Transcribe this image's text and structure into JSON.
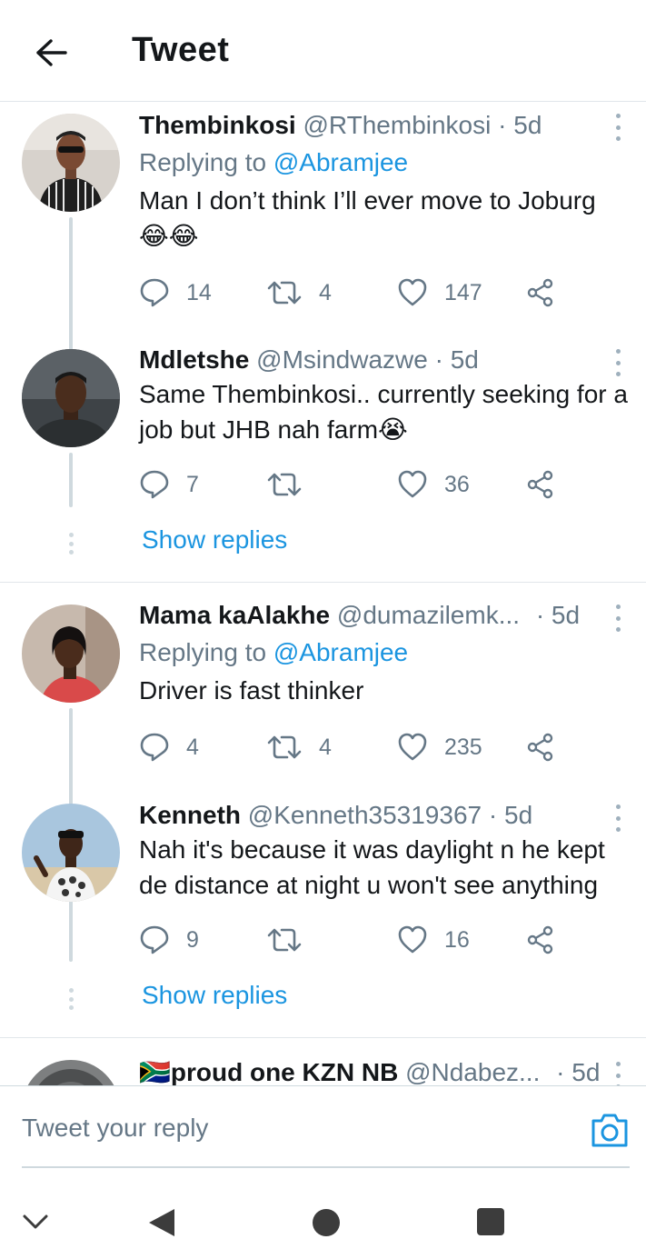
{
  "header": {
    "title": "Tweet"
  },
  "tweets": [
    {
      "name": "Thembinkosi",
      "handle": "@RThembinkosi",
      "time": "· 5d",
      "replying_prefix": "Replying to ",
      "replying_to": "@Abramjee",
      "text": "Man I don’t think I’ll ever move to Joburg",
      "emoji": "😂😂",
      "replies": "14",
      "retweets": "4",
      "likes": "147"
    },
    {
      "name": "Mdletshe",
      "handle": "@Msindwazwe",
      "time": "· 5d",
      "text": "Same Thembinkosi.. currently seeking for a job but JHB nah farm",
      "emoji": "😭",
      "replies": "7",
      "retweets": "",
      "likes": "36",
      "show_replies": "Show replies"
    },
    {
      "name": "Mama kaAlakhe",
      "handle": "@dumazilemk...",
      "time": "· 5d",
      "replying_prefix": "Replying to ",
      "replying_to": "@Abramjee",
      "text": "Driver is fast thinker",
      "replies": "4",
      "retweets": "4",
      "likes": "235"
    },
    {
      "name": "Kenneth",
      "handle": "@Kenneth35319367",
      "time": "· 5d",
      "text": "Nah it's because it was daylight n he kept de distance at night u won't see anything",
      "replies": "9",
      "retweets": "",
      "likes": "16",
      "show_replies": "Show replies"
    },
    {
      "flag": "🇿🇦",
      "name": "proud one KZN NB",
      "handle": "@Ndabez...",
      "time": "· 5d"
    }
  ],
  "compose": {
    "placeholder": "Tweet your reply"
  },
  "colors": {
    "link": "#1b95e0",
    "muted": "#657786",
    "divider": "#e1e6ea",
    "thread_line": "#cfd9de"
  },
  "icons": [
    "back-arrow-icon",
    "reply-icon",
    "retweet-icon",
    "like-icon",
    "share-icon",
    "more-vertical-icon",
    "camera-icon",
    "nav-down-icon",
    "nav-back-icon",
    "nav-home-icon",
    "nav-recents-icon"
  ]
}
